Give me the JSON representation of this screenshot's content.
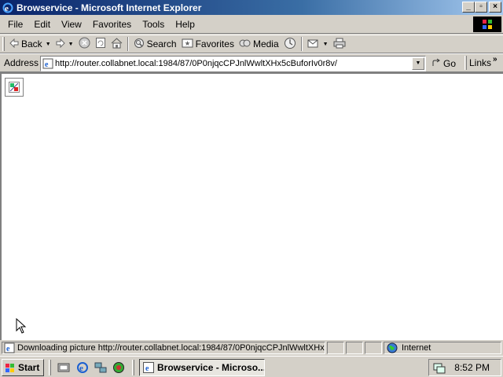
{
  "window": {
    "title": "Browservice - Microsoft Internet Explorer",
    "controls": {
      "minimize": "_",
      "maximize": "▫",
      "close": "×"
    }
  },
  "menubar": {
    "items": [
      "File",
      "Edit",
      "View",
      "Favorites",
      "Tools",
      "Help"
    ]
  },
  "toolbar": {
    "back_label": "Back",
    "search_label": "Search",
    "favorites_label": "Favorites",
    "media_label": "Media"
  },
  "addressbar": {
    "label": "Address",
    "url": "http://router.collabnet.local:1984/87/0P0njqcCPJnlWwltXHx5cBuforIv0r8v/",
    "go_label": "Go",
    "links_label": "Links",
    "links_chevron": "»"
  },
  "statusbar": {
    "text": "Downloading picture http://router.collabnet.local:1984/87/0P0njqcCPJnlWwltXHx5",
    "zone": "Internet"
  },
  "taskbar": {
    "start_label": "Start",
    "task_label": "Browservice - Microso...",
    "clock": "8:52 PM"
  },
  "colors": {
    "titlebar_start": "#0a246a",
    "titlebar_end": "#a6caf0",
    "chrome": "#d4d0c8"
  }
}
